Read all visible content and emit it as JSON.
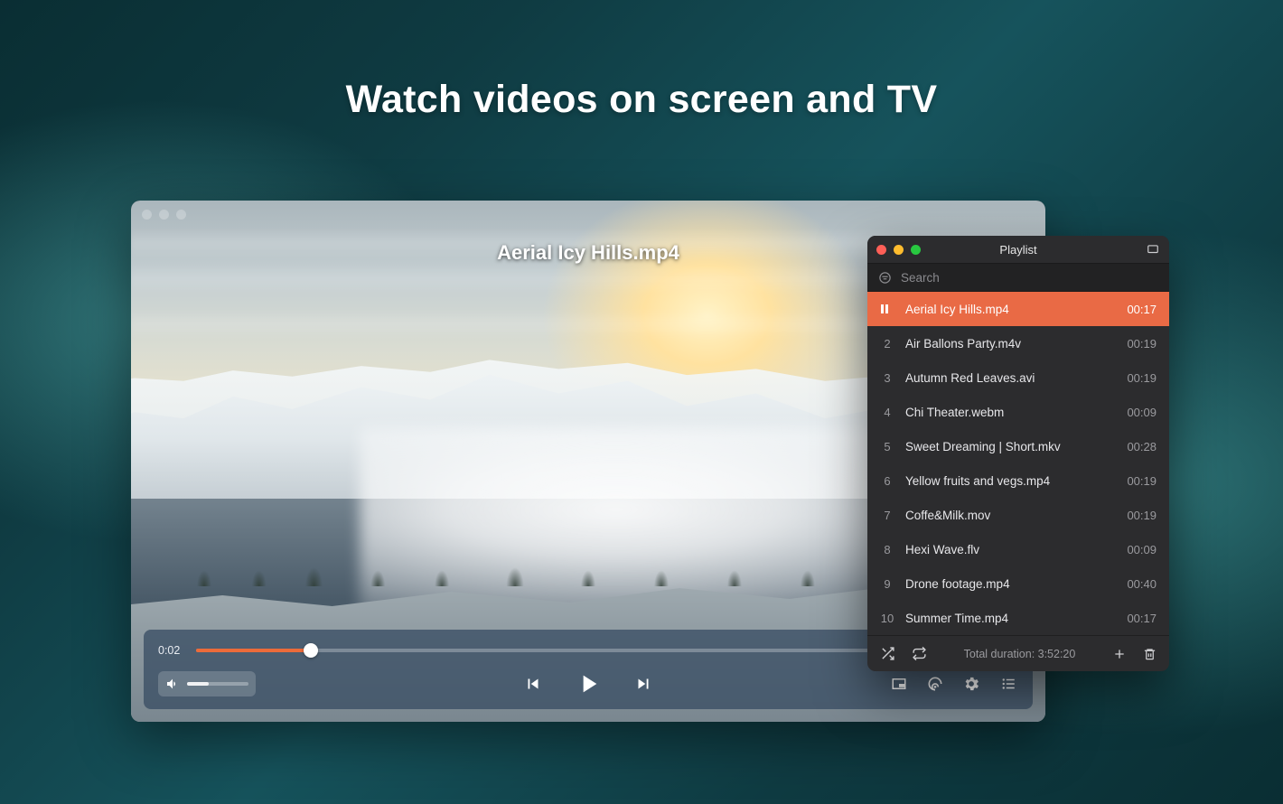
{
  "headline": "Watch videos on screen and TV",
  "player": {
    "now_playing_overlay": "Aerial Icy Hills.mp4",
    "elapsed": "0:02",
    "progress_pct": 14,
    "volume_pct": 35
  },
  "playlist": {
    "window_title": "Playlist",
    "search_placeholder": "Search",
    "total_label": "Total duration: 3:52:20",
    "items": [
      {
        "n": "1",
        "title": "Aerial Icy Hills.mp4",
        "dur": "00:17",
        "active": true
      },
      {
        "n": "2",
        "title": "Air Ballons Party.m4v",
        "dur": "00:19"
      },
      {
        "n": "3",
        "title": "Autumn Red Leaves.avi",
        "dur": "00:19"
      },
      {
        "n": "4",
        "title": "Chi Theater.webm",
        "dur": "00:09"
      },
      {
        "n": "5",
        "title": "Sweet Dreaming | Short.mkv",
        "dur": "00:28"
      },
      {
        "n": "6",
        "title": "Yellow fruits and vegs.mp4",
        "dur": "00:19"
      },
      {
        "n": "7",
        "title": "Coffe&Milk.mov",
        "dur": "00:19"
      },
      {
        "n": "8",
        "title": "Hexi Wave.flv",
        "dur": "00:09"
      },
      {
        "n": "9",
        "title": "Drone footage.mp4",
        "dur": "00:40"
      },
      {
        "n": "10",
        "title": "Summer Time.mp4",
        "dur": "00:17"
      }
    ]
  },
  "colors": {
    "accent": "#e96a45",
    "progress": "#ec6b3a"
  }
}
